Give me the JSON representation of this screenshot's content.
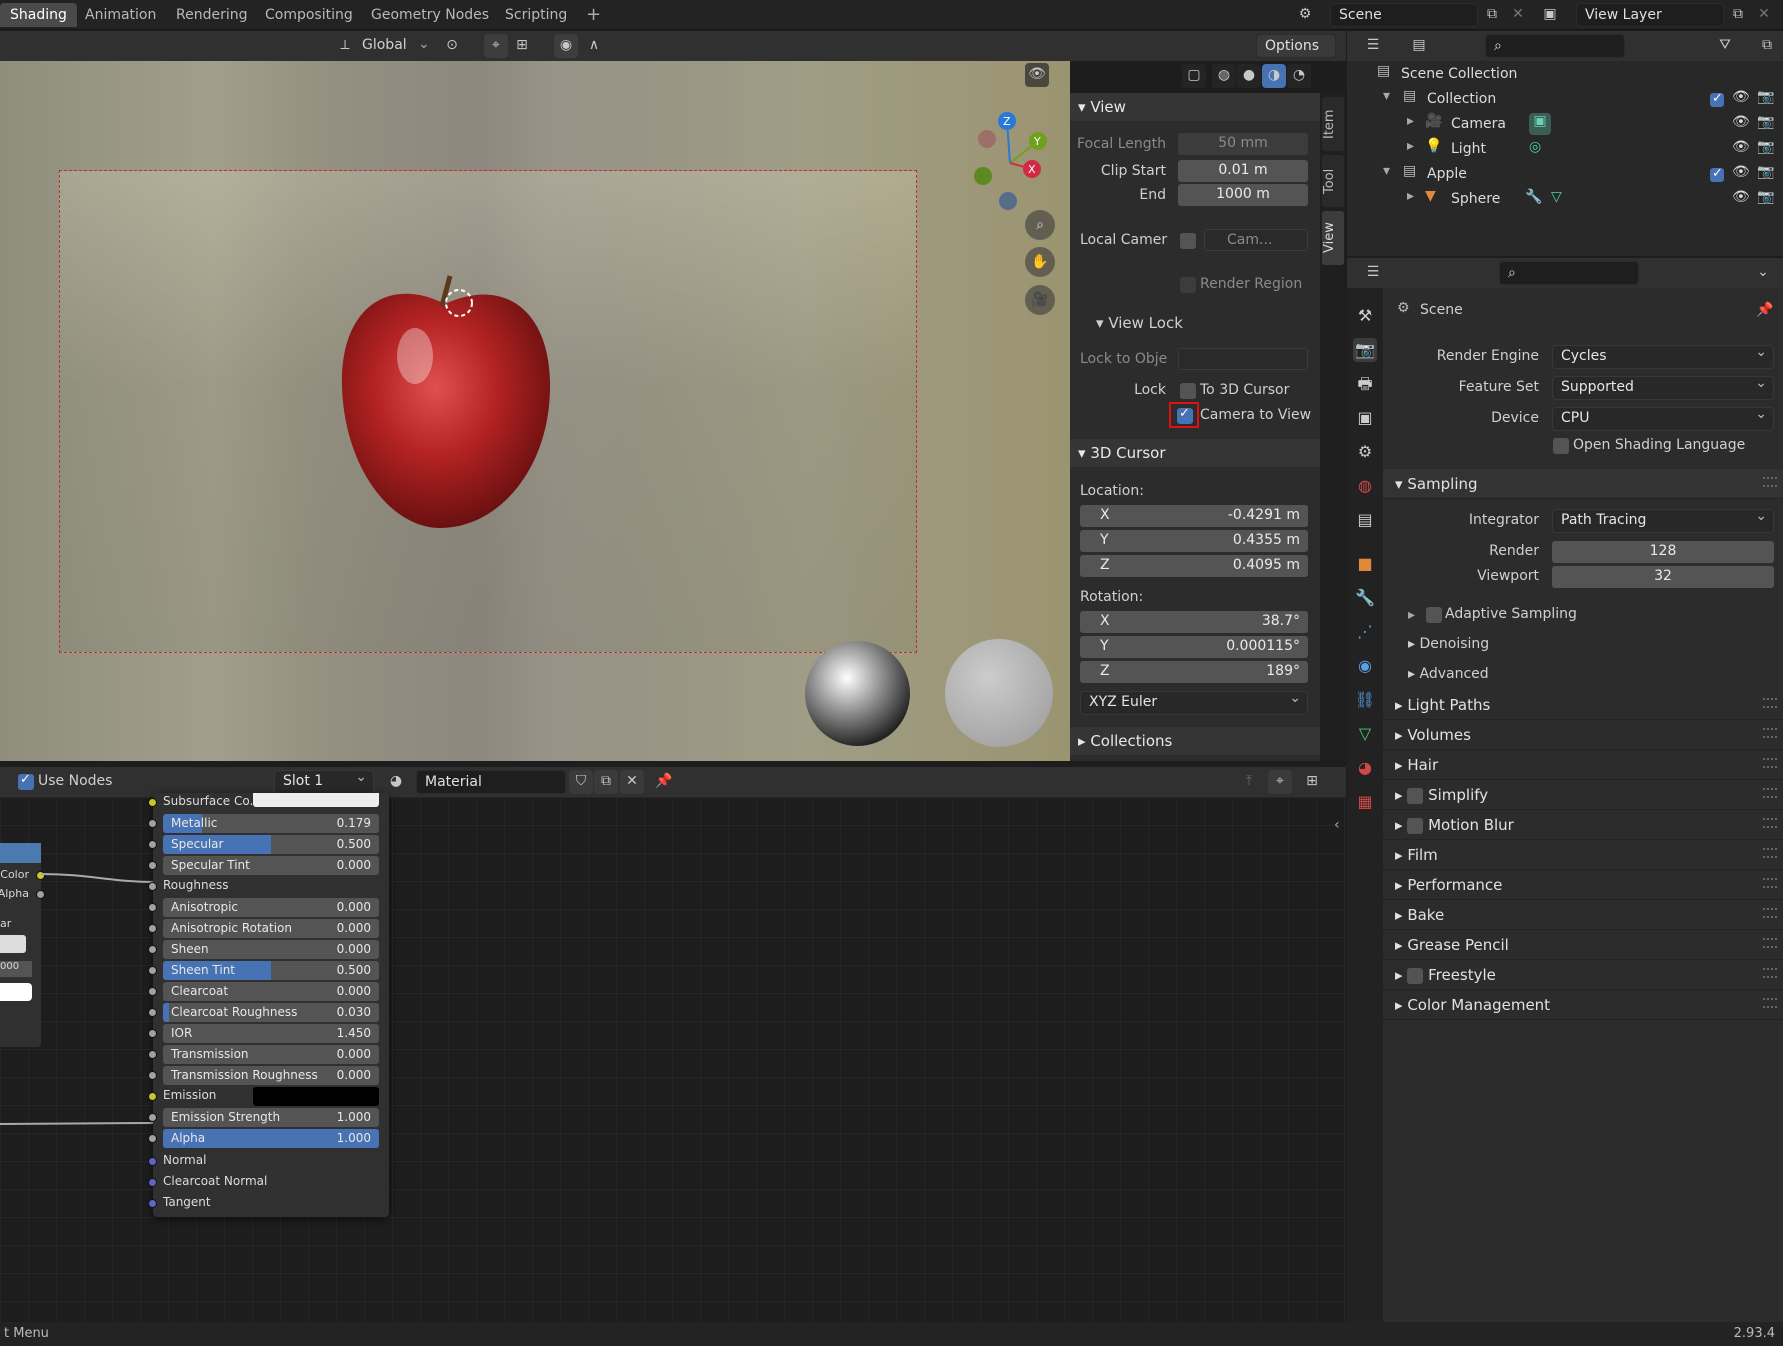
{
  "workspace_tabs": [
    "Shading",
    "Animation",
    "Rendering",
    "Compositing",
    "Geometry Nodes",
    "Scripting"
  ],
  "active_tab": "Shading",
  "scene": {
    "name": "Scene",
    "view_layer": "View Layer"
  },
  "viewport_header": {
    "orientation": "Global",
    "options_label": "Options"
  },
  "npanel": {
    "tabs": [
      "Item",
      "Tool",
      "View"
    ],
    "view_section": "View",
    "focal_length_label": "Focal Length",
    "focal_length": "50 mm",
    "clip_start_label": "Clip Start",
    "clip_start": "0.01 m",
    "end_label": "End",
    "end": "1000 m",
    "local_camera_label": "Local Camer",
    "local_camera_value": "Cam...",
    "render_region_label": "Render Region",
    "view_lock_section": "View Lock",
    "lock_to_object_label": "Lock to Obje",
    "lock_label": "Lock",
    "to_3d_cursor_label": "To 3D Cursor",
    "camera_to_view_label": "Camera to View",
    "cursor_section": "3D Cursor",
    "location_label": "Location:",
    "loc_x": "-0.4291 m",
    "loc_y": "0.4355 m",
    "loc_z": "0.4095 m",
    "rotation_label": "Rotation:",
    "rot_x": "38.7°",
    "rot_y": "0.000115°",
    "rot_z": "189°",
    "rotation_mode": "XYZ Euler",
    "collections_section": "Collections",
    "axis_x": "X",
    "axis_y": "Y",
    "axis_z": "Z"
  },
  "gizmo": {
    "x": "X",
    "y": "Y",
    "z": "Z"
  },
  "outliner": {
    "root": "Scene Collection",
    "items": [
      {
        "label": "Collection"
      },
      {
        "label": "Camera"
      },
      {
        "label": "Light"
      },
      {
        "label": "Apple"
      },
      {
        "label": "Sphere"
      }
    ]
  },
  "properties": {
    "title": "Scene",
    "render_engine_label": "Render Engine",
    "render_engine": "Cycles",
    "feature_set_label": "Feature Set",
    "feature_set": "Supported",
    "device_label": "Device",
    "device": "CPU",
    "osl_label": "Open Shading Language",
    "sampling": "Sampling",
    "integrator_label": "Integrator",
    "integrator": "Path Tracing",
    "render_label": "Render",
    "render_samples": "128",
    "viewport_label": "Viewport",
    "viewport_samples": "32",
    "adaptive_sampling": "Adaptive Sampling",
    "denoising": "Denoising",
    "advanced": "Advanced",
    "panels": [
      "Light Paths",
      "Volumes",
      "Hair",
      "Simplify",
      "Motion Blur",
      "Film",
      "Performance",
      "Bake",
      "Grease Pencil",
      "Freestyle",
      "Color Management"
    ]
  },
  "node_editor": {
    "use_nodes_label": "Use Nodes",
    "slot": "Slot 1",
    "material": "Material",
    "left_node": {
      "color": "Color",
      "alpha": "Alpha",
      "mode": "ar",
      "value": "000"
    },
    "bsdf": {
      "subsurface_color": "Subsurface Co...",
      "sliders": [
        {
          "label": "Metallic",
          "value": "0.179",
          "fraction": 0.179
        },
        {
          "label": "Specular",
          "value": "0.500",
          "fraction": 0.5
        },
        {
          "label": "Specular Tint",
          "value": "0.000",
          "fraction": 0
        },
        {
          "label": "Roughness",
          "value": "",
          "fraction": 0
        },
        {
          "label": "Anisotropic",
          "value": "0.000",
          "fraction": 0
        },
        {
          "label": "Anisotropic Rotation",
          "value": "0.000",
          "fraction": 0
        },
        {
          "label": "Sheen",
          "value": "0.000",
          "fraction": 0
        },
        {
          "label": "Sheen Tint",
          "value": "0.500",
          "fraction": 0.5
        },
        {
          "label": "Clearcoat",
          "value": "0.000",
          "fraction": 0
        },
        {
          "label": "Clearcoat Roughness",
          "value": "0.030",
          "fraction": 0.03
        },
        {
          "label": "IOR",
          "value": "1.450",
          "fraction": 0
        },
        {
          "label": "Transmission",
          "value": "0.000",
          "fraction": 0
        },
        {
          "label": "Transmission Roughness",
          "value": "0.000",
          "fraction": 0
        },
        {
          "label": "Emission",
          "value": "",
          "fraction": 0
        },
        {
          "label": "Emission Strength",
          "value": "1.000",
          "fraction": 0
        },
        {
          "label": "Alpha",
          "value": "1.000",
          "fraction": 1
        }
      ],
      "normal": "Normal",
      "clearcoat_normal": "Clearcoat Normal",
      "tangent": "Tangent"
    }
  },
  "status": {
    "left": "t Menu",
    "version": "2.93.4"
  }
}
